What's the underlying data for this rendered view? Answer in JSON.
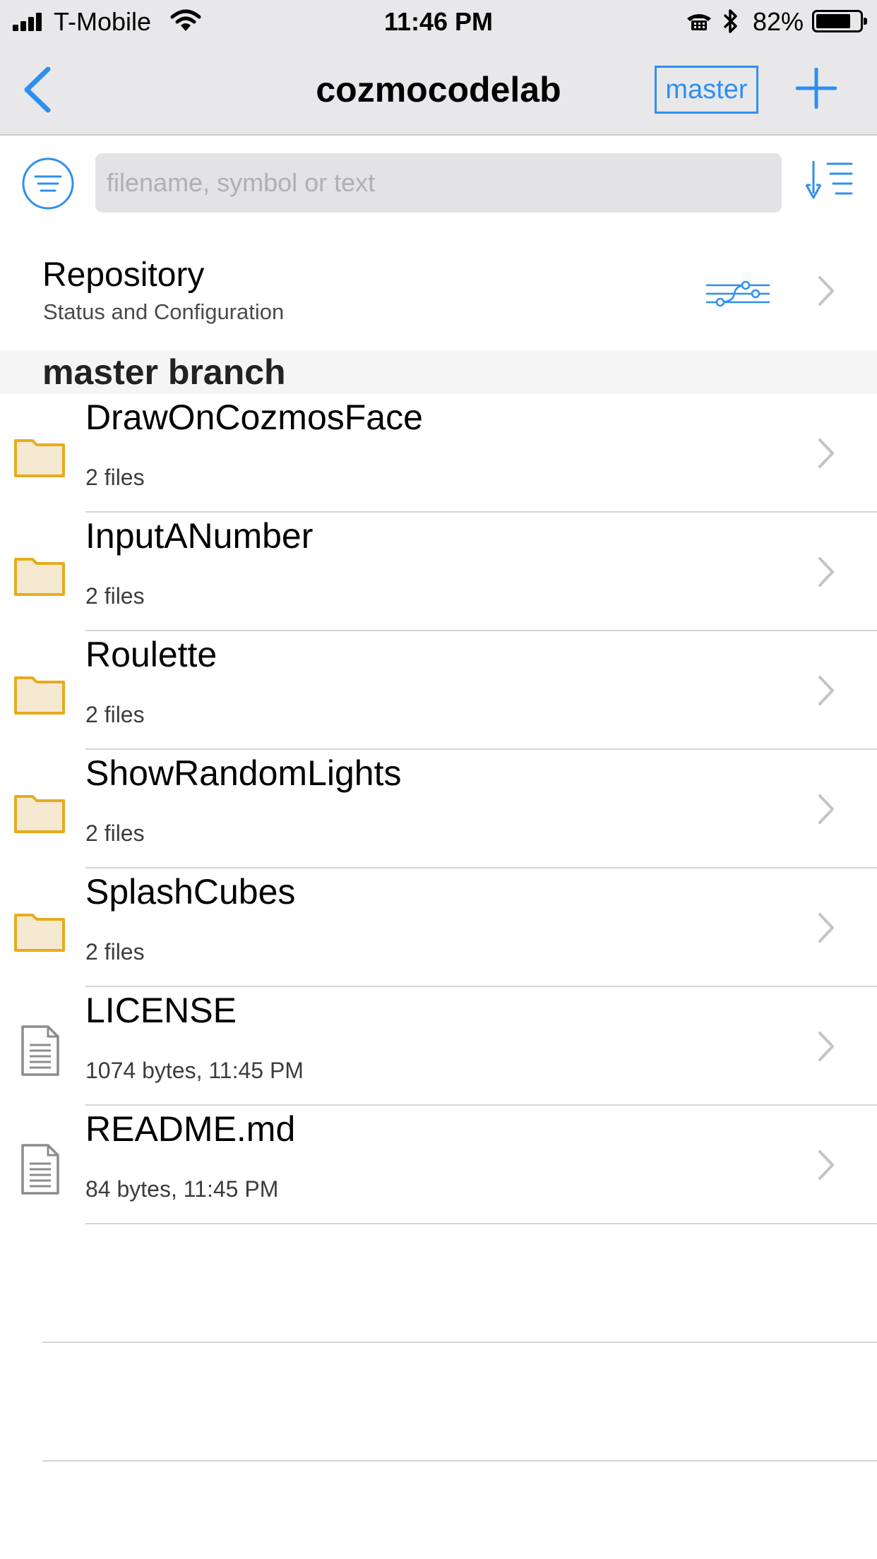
{
  "status_bar": {
    "carrier": "T-Mobile",
    "time": "11:46 PM",
    "battery_percent": "82%",
    "battery_level": 0.82
  },
  "nav": {
    "title": "cozmocodelab",
    "branch_button": "master",
    "back_icon": "chevron-left-icon",
    "add_icon": "plus-icon"
  },
  "search": {
    "placeholder": "filename, symbol or text",
    "value": ""
  },
  "repository": {
    "title": "Repository",
    "subtitle": "Status and Configuration"
  },
  "section": {
    "label": "master branch"
  },
  "items": [
    {
      "name": "DrawOnCozmosFace",
      "meta": "2 files",
      "kind": "folder"
    },
    {
      "name": "InputANumber",
      "meta": "2 files",
      "kind": "folder"
    },
    {
      "name": "Roulette",
      "meta": "2 files",
      "kind": "folder"
    },
    {
      "name": "ShowRandomLights",
      "meta": "2 files",
      "kind": "folder"
    },
    {
      "name": "SplashCubes",
      "meta": "2 files",
      "kind": "folder"
    },
    {
      "name": "LICENSE",
      "meta": "1074 bytes, 11:45 PM",
      "kind": "file"
    },
    {
      "name": "README.md",
      "meta": "84 bytes, 11:45 PM",
      "kind": "file"
    }
  ],
  "colors": {
    "accent": "#2f8ff0",
    "folder_stroke": "#e6ac1e",
    "folder_fill": "#f5e9d2",
    "file_stroke": "#8c8c8c",
    "nav_bg": "#e8e8ea"
  }
}
